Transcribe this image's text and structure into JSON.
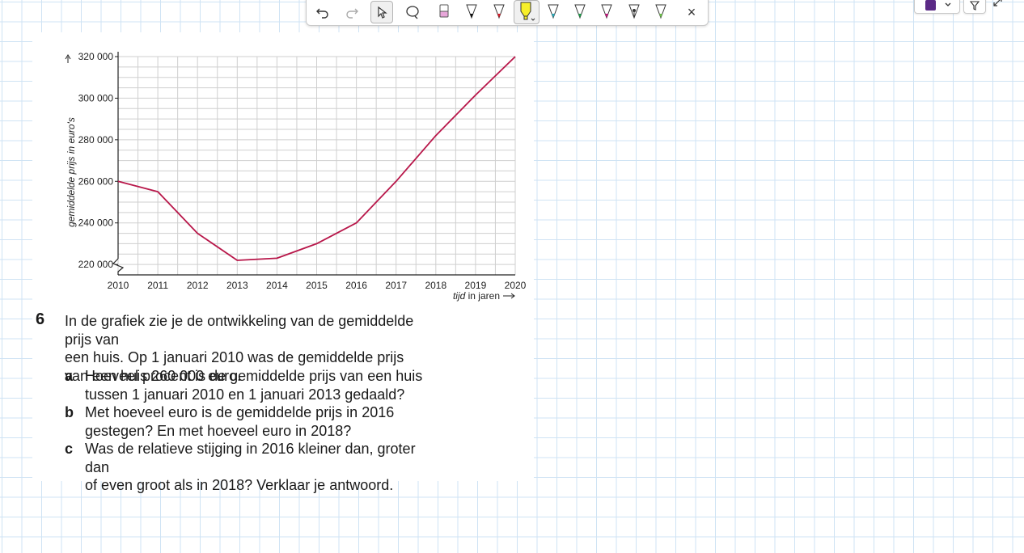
{
  "toolbar": {
    "tools": [
      "undo-icon",
      "redo-icon",
      "select-arrow-icon",
      "lasso-icon",
      "eraser-icon",
      "pen-black-icon",
      "pen-red-icon",
      "highlighter-yellow-icon",
      "pen-teal-icon",
      "pen-green-icon",
      "pen-pink-icon",
      "pen-fountain-icon",
      "pen-lightgreen-icon",
      "close-icon"
    ],
    "selected_tool": "select-arrow-icon",
    "close_glyph": "×"
  },
  "right_tools": {
    "color_swatch": "#5b2a86",
    "icons": [
      "color-dropdown-icon",
      "filter-icon",
      "expand-icon"
    ]
  },
  "chart_data": {
    "type": "line",
    "title": "",
    "xlabel": "tijd in jaren",
    "xlabel_italic_part": "tijd",
    "xlabel_rest": " in jaren",
    "ylabel": "gemiddelde prijs in euro's",
    "x": [
      "2010",
      "2011",
      "2012",
      "2013",
      "2014",
      "2015",
      "2016",
      "2017",
      "2018",
      "2019",
      "2020"
    ],
    "series": [
      {
        "name": "",
        "color": "#b8174a",
        "values": [
          260000,
          255000,
          235000,
          222000,
          223000,
          230000,
          240000,
          260000,
          282000,
          301500,
          320000
        ]
      }
    ],
    "ylim": [
      215000,
      320000
    ],
    "y_ticks": [
      220000,
      240000,
      260000,
      280000,
      300000,
      320000
    ],
    "y_tick_labels": [
      "220 000",
      "240 000",
      "260 000",
      "280 000",
      "300 000",
      "320 000"
    ],
    "grid": true,
    "axis_break": true
  },
  "exercise": {
    "number": "6",
    "intro_lines": [
      "In de grafiek zie je de ontwikkeling van de gemiddelde prijs van",
      "een huis. Op 1 januari 2010 was de gemiddelde prijs",
      "van een huis 260 000 euro."
    ],
    "questions": [
      {
        "letter": "a",
        "lines": [
          "Hoeveel procent is de gemiddelde prijs van een huis",
          "tussen 1 januari 2010 en 1 januari 2013 gedaald?"
        ]
      },
      {
        "letter": "b",
        "lines": [
          "Met hoeveel euro is de gemiddelde prijs in 2016",
          "gestegen? En met hoeveel euro in 2018?"
        ]
      },
      {
        "letter": "c",
        "lines": [
          "Was de relatieve stijging in 2016 kleiner dan, groter dan",
          "of even groot als in 2018? Verklaar je antwoord."
        ]
      }
    ]
  }
}
